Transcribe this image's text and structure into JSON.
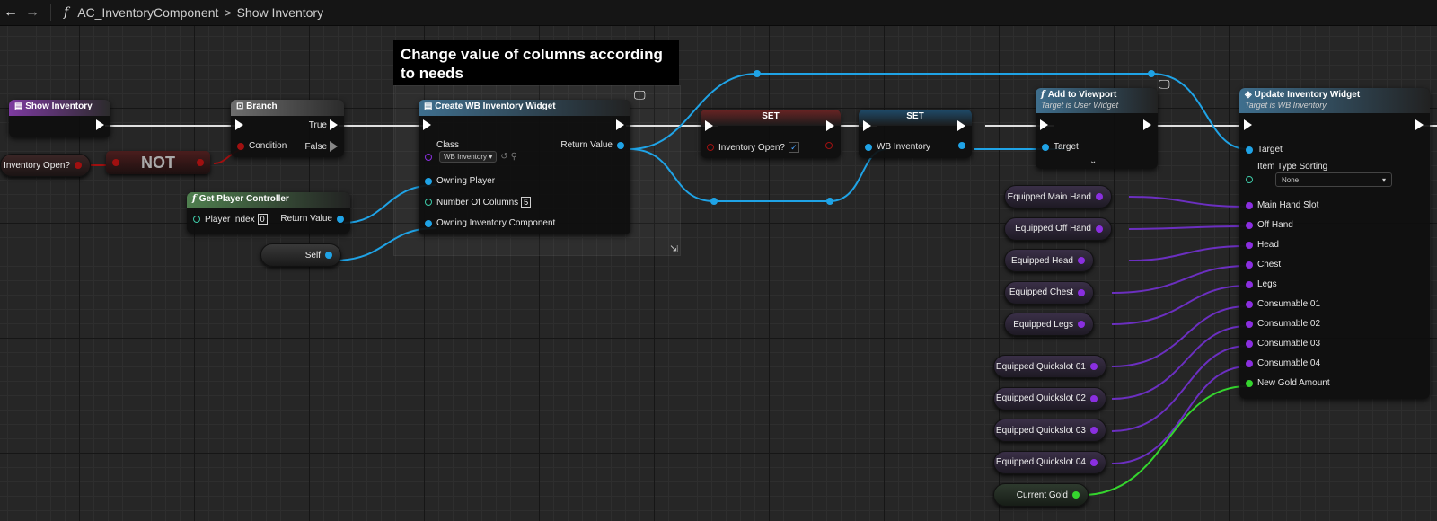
{
  "toolbar": {
    "back_icon": "back-arrow-icon",
    "forward_icon": "forward-arrow-icon",
    "function_icon": "f",
    "breadcrumb_root": "AC_InventoryComponent",
    "breadcrumb_separator": ">",
    "breadcrumb_current": "Show Inventory"
  },
  "comment": {
    "title_line1": "Change value of columns according",
    "title_line2": "to needs"
  },
  "nodes": {
    "show_inventory": {
      "title": "Show Inventory"
    },
    "inventory_open_var": {
      "label": "Inventory Open?"
    },
    "not": {
      "label": "NOT"
    },
    "branch": {
      "title": "Branch",
      "condition": "Condition",
      "true_label": "True",
      "false_label": "False"
    },
    "get_player_controller": {
      "title": "Get Player Controller",
      "player_index": "Player Index",
      "player_index_value": "0",
      "return_value": "Return Value"
    },
    "self": {
      "label": "Self"
    },
    "create_widget": {
      "title": "Create WB Inventory Widget",
      "class_label": "Class",
      "class_value": "WB Inventory",
      "return_value": "Return Value",
      "owning_player": "Owning Player",
      "number_of_columns": "Number Of Columns",
      "number_of_columns_value": "5",
      "owning_inventory_component": "Owning Inventory Component"
    },
    "set_inventory_open": {
      "title": "SET",
      "label": "Inventory Open?",
      "checked": true
    },
    "set_wb_inventory": {
      "title": "SET",
      "label": "WB Inventory"
    },
    "add_to_viewport": {
      "title": "Add to Viewport",
      "subtitle": "Target is User Widget",
      "target": "Target"
    },
    "update_inventory": {
      "title": "Update Inventory Widget",
      "subtitle": "Target is WB Inventory",
      "target": "Target",
      "item_type_sorting": "Item Type Sorting",
      "sorting_value": "None",
      "pins": [
        "Main Hand Slot",
        "Off Hand",
        "Head",
        "Chest",
        "Legs",
        "Consumable 01",
        "Consumable 02",
        "Consumable 03",
        "Consumable 04",
        "New Gold Amount"
      ]
    }
  },
  "equipped_vars": [
    "Equipped Main Hand",
    "Equipped Off Hand",
    "Equipped Head",
    "Equipped Chest",
    "Equipped Legs"
  ],
  "quickslot_vars": [
    "Equipped Quickslot 01",
    "Equipped Quickslot 02",
    "Equipped Quickslot 03",
    "Equipped Quickslot 04"
  ],
  "gold_var": "Current Gold",
  "colors": {
    "exec": "#ffffff",
    "object_pin": "#1fa3e6",
    "bool_pin": "#a01010",
    "struct_pin": "#8a2fe0",
    "int_pin": "#35d52e",
    "background": "#262626"
  }
}
